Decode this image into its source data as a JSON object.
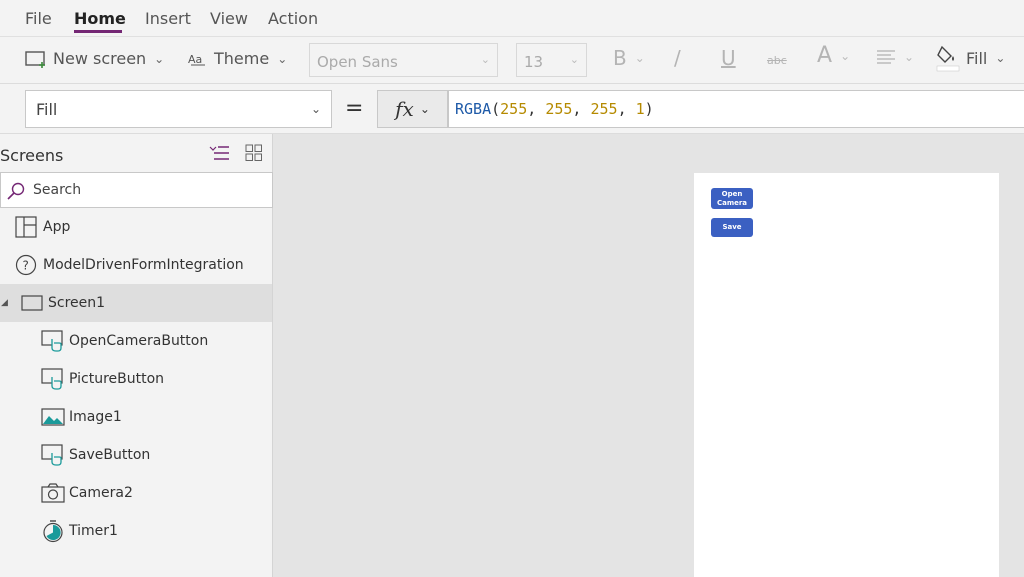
{
  "menu": {
    "items": [
      "File",
      "Home",
      "Insert",
      "View",
      "Action"
    ],
    "active": "Home"
  },
  "ribbon": {
    "new_screen": "New screen",
    "theme": "Theme",
    "font": "Open Sans",
    "font_size": "13",
    "bold": "B",
    "italic": "/",
    "underline": "U",
    "strike": "abc",
    "font_color": "A",
    "fill": "Fill"
  },
  "formula": {
    "property": "Fill",
    "equals": "=",
    "fx": "fx",
    "fn": "RGBA",
    "open": "(",
    "n1": "255",
    "sep1": ", ",
    "n2": "255",
    "sep2": ", ",
    "n3": "255",
    "sep3": ", ",
    "n4": "1",
    "close": ")"
  },
  "panel": {
    "title": "Screens",
    "search_placeholder": "Search",
    "items": [
      {
        "label": "App"
      },
      {
        "label": "ModelDrivenFormIntegration"
      },
      {
        "label": "Screen1"
      },
      {
        "label": "OpenCameraButton"
      },
      {
        "label": "PictureButton"
      },
      {
        "label": "Image1"
      },
      {
        "label": "SaveButton"
      },
      {
        "label": "Camera2"
      },
      {
        "label": "Timer1"
      }
    ]
  },
  "canvas": {
    "open_camera_line1": "Open",
    "open_camera_line2": "Camera",
    "save": "Save"
  },
  "colors": {
    "accent": "#742774",
    "app_button": "#3b60c2",
    "screen_fill": "#ffffff"
  }
}
